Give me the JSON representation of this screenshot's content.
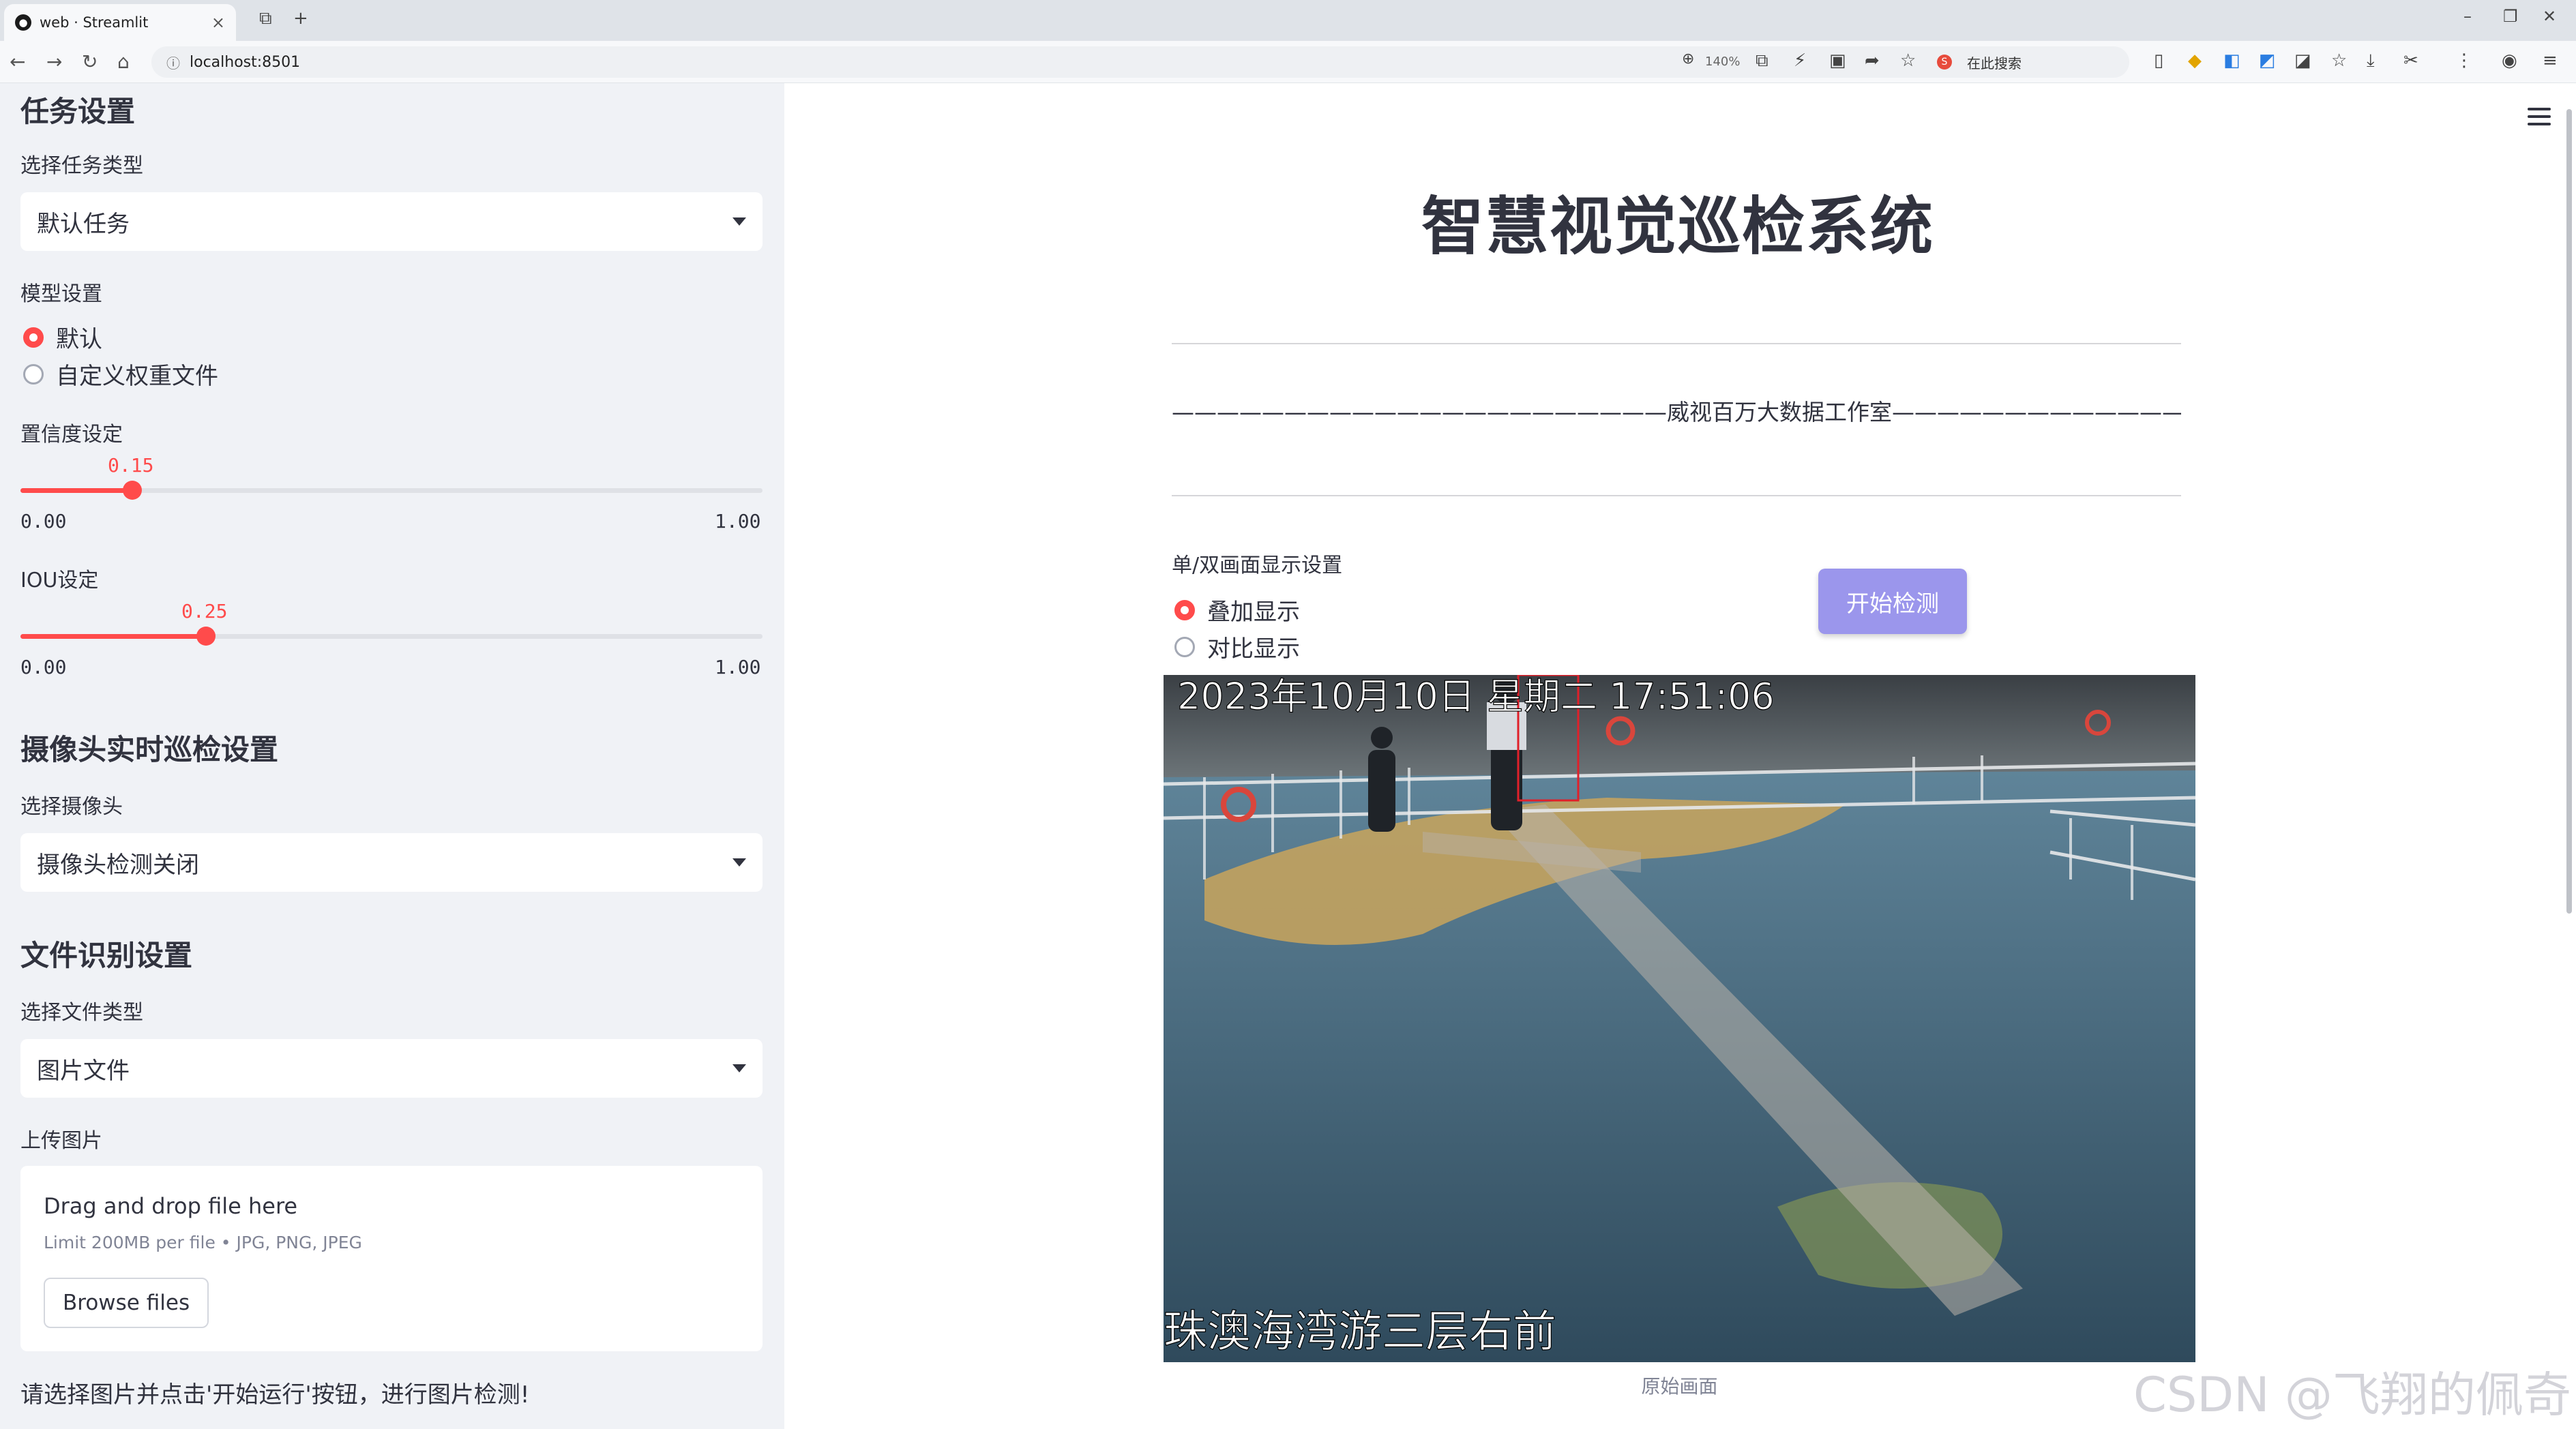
{
  "browser": {
    "tab_title": "web · Streamlit",
    "url": "localhost:8501",
    "zoom": "140%",
    "search_placeholder": "在此搜索"
  },
  "sidebar": {
    "task_section": {
      "heading": "任务设置",
      "task_type_label": "选择任务类型",
      "task_type_value": "默认任务",
      "model_label": "模型设置",
      "model_options": [
        "默认",
        "自定义权重文件"
      ],
      "model_selected_index": 0
    },
    "confidence": {
      "label": "置信度设定",
      "value": "0.15",
      "min": "0.00",
      "max": "1.00"
    },
    "iou": {
      "label": "IOU设定",
      "value": "0.25",
      "min": "0.00",
      "max": "1.00"
    },
    "camera_section": {
      "heading": "摄像头实时巡检设置",
      "camera_label": "选择摄像头",
      "camera_value": "摄像头检测关闭"
    },
    "file_section": {
      "heading": "文件识别设置",
      "file_type_label": "选择文件类型",
      "file_type_value": "图片文件",
      "upload_label": "上传图片",
      "upload_drag_text": "Drag and drop file here",
      "upload_limit_text": "Limit 200MB per file • JPG, PNG, JPEG",
      "browse_button": "Browse files"
    },
    "instruction": "请选择图片并点击'开始运行'按钮，进行图片检测!"
  },
  "main": {
    "title": "智慧视觉巡检系统",
    "subtitle": "——————————————————————威视百万大数据工作室——————————————————————",
    "display_label": "单/双画面显示设置",
    "display_options": [
      "叠加显示",
      "对比显示"
    ],
    "display_selected_index": 0,
    "start_button": "开始检测",
    "video_timestamp": "2023年10月10日 星期二 17:51:06",
    "video_location": "珠澳海湾游三层右前",
    "caption": "原始画面",
    "watermark": "CSDN @飞翔的佩奇"
  },
  "colors": {
    "accent": "#ff4b4b",
    "sidebar_bg": "#f0f2f6",
    "button_bg": "#9b96ec",
    "text": "#31333f"
  }
}
